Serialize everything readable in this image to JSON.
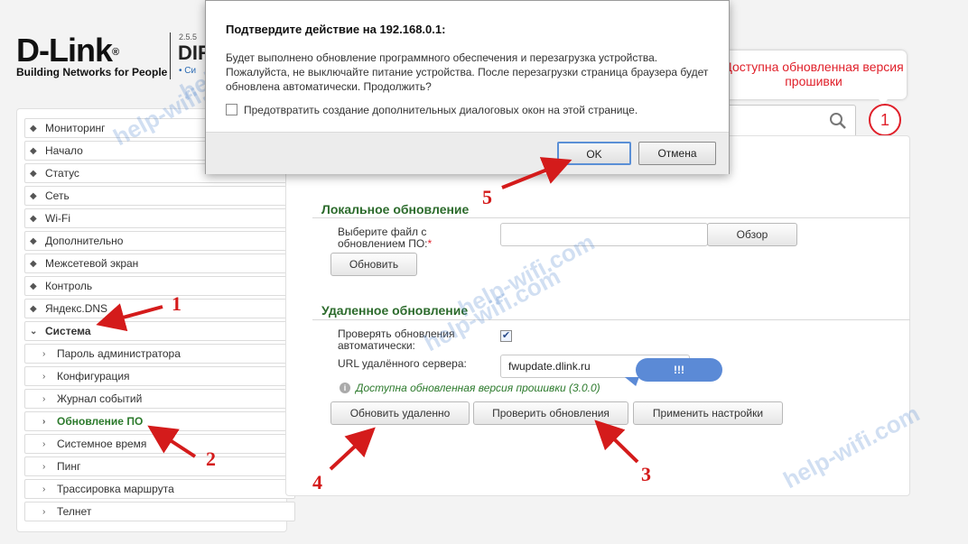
{
  "header": {
    "brand": "D-Link",
    "tagline": "Building Networks for People",
    "fw_version": "2.5.5",
    "model": "DIR",
    "system_label": "• Си"
  },
  "notice": {
    "text": "Доступна обновленная версия прошивки",
    "badge": "1"
  },
  "sidebar": {
    "items": [
      {
        "label": "Мониторинг"
      },
      {
        "label": "Начало"
      },
      {
        "label": "Статус"
      },
      {
        "label": "Сеть"
      },
      {
        "label": "Wi-Fi"
      },
      {
        "label": "Дополнительно"
      },
      {
        "label": "Межсетевой экран"
      },
      {
        "label": "Контроль"
      },
      {
        "label": "Яндекс.DNS"
      },
      {
        "label": "Система"
      },
      {
        "label": "Пароль администратора"
      },
      {
        "label": "Конфигурация"
      },
      {
        "label": "Журнал событий"
      },
      {
        "label": "Обновление ПО"
      },
      {
        "label": "Системное время"
      },
      {
        "label": "Пинг"
      },
      {
        "label": "Трассировка маршрута"
      },
      {
        "label": "Телнет"
      }
    ]
  },
  "local_update": {
    "title": "Локальное обновление",
    "file_label": "Выберите файл с обновлением ПО:",
    "required_mark": "*",
    "browse_label": "Обзор",
    "update_label": "Обновить"
  },
  "remote_update": {
    "title": "Удаленное обновление",
    "auto_check_label": "Проверять обновления автоматически:",
    "auto_check_checked": true,
    "server_url_label": "URL удалённого сервера:",
    "server_url_value": "fwupdate.dlink.ru",
    "available_text": "Доступна обновленная версия прошивки (3.0.0)",
    "update_remote_label": "Обновить удаленно",
    "check_updates_label": "Проверить обновления",
    "apply_label": "Применить настройки"
  },
  "callout": {
    "text": "!!!"
  },
  "dialog": {
    "title": "Подтвердите действие на 192.168.0.1:",
    "message": "Будет выполнено обновление программного обеспечения и перезагрузка устройства. Пожалуйста, не выключайте питание устройства. После перезагрузки страница браузера будет обновлена автоматически. Продолжить?",
    "prevent_label": "Предотвратить создание дополнительных диалоговых окон на этой странице.",
    "ok_label": "OK",
    "cancel_label": "Отмена"
  },
  "watermark": "help-wifi.com",
  "steps": [
    "1",
    "2",
    "3",
    "4",
    "5"
  ],
  "colors": {
    "accent_green": "#2c6b2c",
    "alert_red": "#e0202a",
    "annotation_red": "#d41b1b",
    "callout_blue": "#5b8ad6"
  }
}
